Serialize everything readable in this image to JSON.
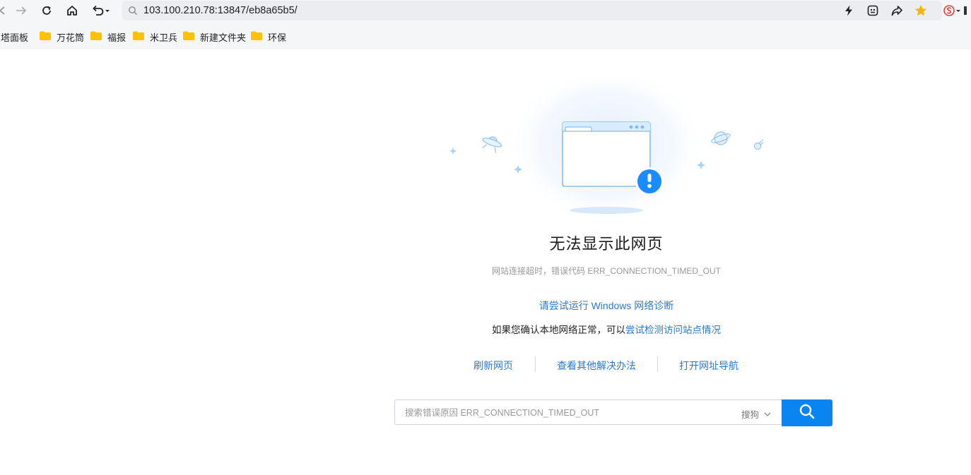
{
  "browser": {
    "url": "103.100.210.78:13847/eb8a65b5/",
    "icons": {
      "back": "back-arrow-icon",
      "forward": "forward-arrow-icon",
      "reload": "reload-icon",
      "home": "home-icon",
      "undo": "undo-icon",
      "address_search": "search-icon",
      "lightning": "lightning-icon",
      "extension": "extension-icon",
      "share": "share-icon",
      "star": "star-icon",
      "sogou": "sogou-logo-icon"
    },
    "star_color": "#f4b400",
    "accent_color": "#2e78c7"
  },
  "bookmarks": [
    {
      "label": "宝塔面板"
    },
    {
      "label": "万花筒"
    },
    {
      "label": "福报"
    },
    {
      "label": "米卫兵"
    },
    {
      "label": "新建文件夹"
    },
    {
      "label": "环保"
    }
  ],
  "error": {
    "title": "无法显示此网页",
    "subtitle": "网站连接超时，错误代码 ERR_CONNECTION_TIMED_OUT",
    "diagnose_link": "请尝试运行 Windows 网络诊断",
    "hint_prefix": "如果您确认本地网络正常，可以",
    "hint_link": "尝试检测访问站点情况"
  },
  "actions": [
    {
      "label": "刷新网页"
    },
    {
      "label": "查看其他解决办法"
    },
    {
      "label": "打开网址导航"
    }
  ],
  "search": {
    "placeholder": "搜索错误原因 ERR_CONNECTION_TIMED_OUT",
    "value": "",
    "engine": "搜狗",
    "button_color": "#0a84f0"
  }
}
